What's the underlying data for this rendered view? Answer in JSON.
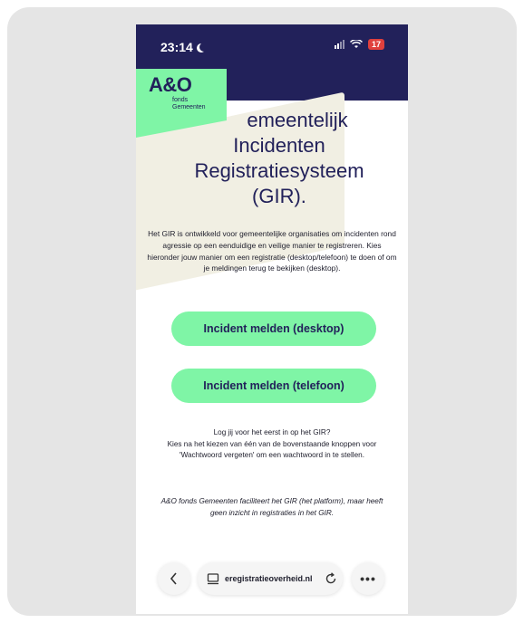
{
  "status_bar": {
    "time": "23:14",
    "battery": "17"
  },
  "brand": {
    "logo": "A&O",
    "sub_line1": "fonds",
    "sub_line2": "Gemeenten"
  },
  "page": {
    "title_lines": [
      "emeentelijk",
      "Incidenten",
      "Registratiesysteem",
      "(GIR)."
    ],
    "intro": "Het GIR is ontwikkeld voor gemeentelijke organisaties om incidenten rond agressie op een eenduidige en veilige manier te registreren. Kies hieronder jouw manier om een registratie (desktop/telefoon) te doen of om je meldingen terug te bekijken (desktop).",
    "button_desktop": "Incident melden (desktop)",
    "button_phone": "Incident melden (telefoon)",
    "login_line1": "Log jij voor het eerst in op het GIR?",
    "login_line2": "Kies na het kiezen van één van de bovenstaande knoppen voor 'Wachtwoord vergeten' om een wachtwoord in te stellen.",
    "disclaimer": "A&O fonds Gemeenten faciliteert het GIR (het platform), maar heeft geen inzicht in registraties in het GIR."
  },
  "browser": {
    "url": "eregistratieoverheid.nl"
  },
  "icons": [
    "moon-icon",
    "signal-icon",
    "wifi-icon",
    "back-chevron-icon",
    "tabs-icon",
    "reload-icon",
    "more-icon"
  ],
  "colors": {
    "navy": "#22215a",
    "green": "#7ff5a6",
    "beige": "#f1efe3"
  }
}
